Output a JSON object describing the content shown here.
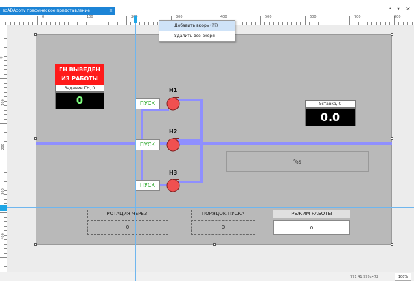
{
  "tab": {
    "title": "scADAconv графическое представление",
    "close": "×"
  },
  "window": {
    "pin": "•",
    "restore": "▾",
    "close": "×"
  },
  "ruler": {
    "h_labels": [
      "0",
      "100",
      "200",
      "300",
      "400",
      "500",
      "600",
      "700",
      "800"
    ],
    "v_labels": [
      "0",
      "100",
      "200",
      "300",
      "400"
    ]
  },
  "context_menu": {
    "items": [
      "Добавить вкорь (??)",
      "Удалить все вкоря"
    ]
  },
  "alarm": {
    "line1": "ГН ВЫВЕДЕН",
    "line2": "ИЗ РАБОТЫ"
  },
  "gn_task": {
    "label": "Задание ГН, 0",
    "value": "0"
  },
  "setpoint": {
    "label": "Уставка, 0",
    "value": "0.0"
  },
  "pumps": [
    {
      "name": "H1",
      "button": "ПУСК"
    },
    {
      "name": "H2",
      "button": "ПУСК"
    },
    {
      "name": "H3",
      "button": "ПУСК"
    }
  ],
  "text_placeholder": "%s",
  "bottom_boxes": [
    {
      "label": "РОТАЦИЯ ЧЕРЕЗ:",
      "value": "0"
    },
    {
      "label": "ПОРЯДОК ПУСКА",
      "value": "0"
    },
    {
      "label": "РЕЖИМ РАБОТЫ",
      "value": "0"
    }
  ],
  "status": {
    "coords": "771 41 999x472",
    "zoom": "100%"
  },
  "colors": {
    "accent": "#1c84d6",
    "pipe": "#8f8fff",
    "alarm": "#ff1a1a",
    "pump": "#f05050",
    "run": "#1fa11f"
  }
}
